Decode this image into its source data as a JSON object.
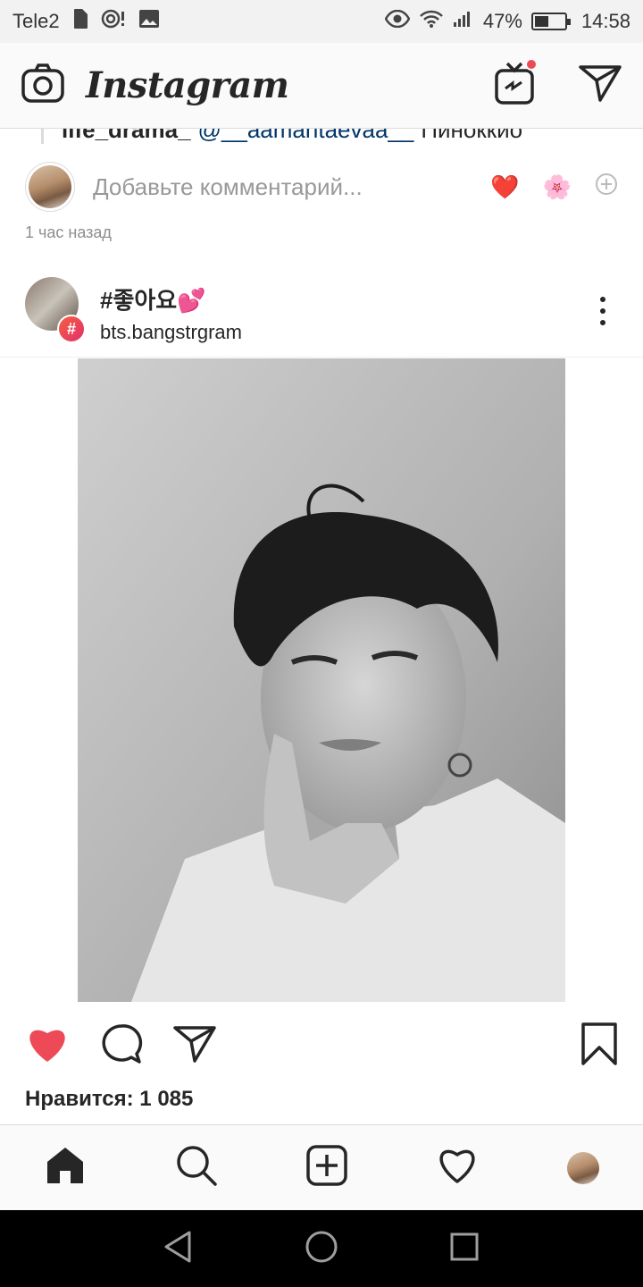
{
  "status_bar": {
    "carrier": "Tele2",
    "battery_percent": "47%",
    "battery_level": 0.47,
    "time": "14:58"
  },
  "header": {
    "logo": "Instagram",
    "icons": [
      "camera-icon",
      "igtv-icon",
      "direct-message-icon"
    ],
    "igtv_notification": true
  },
  "prev_post": {
    "comment_user": "life_drama_",
    "comment_mention": "@__aamantaevaa__",
    "comment_text": "Пиноккио",
    "add_comment_placeholder": "Добавьте комментарий...",
    "quick_reactions": [
      "❤️",
      "🌸",
      "⊕"
    ],
    "time_ago": "1 час назад"
  },
  "post": {
    "hashtag": "#좋아요💕",
    "account": "bts.bangstrgram",
    "badge": "#",
    "likes": "Нравится: 1 085"
  },
  "bottom_nav": [
    "home-icon",
    "search-icon",
    "new-post-icon",
    "activity-icon",
    "profile-avatar"
  ],
  "colors": {
    "like_red": "#ed4956",
    "text": "#262626",
    "muted": "#8e8e8e",
    "mention": "#003569"
  }
}
